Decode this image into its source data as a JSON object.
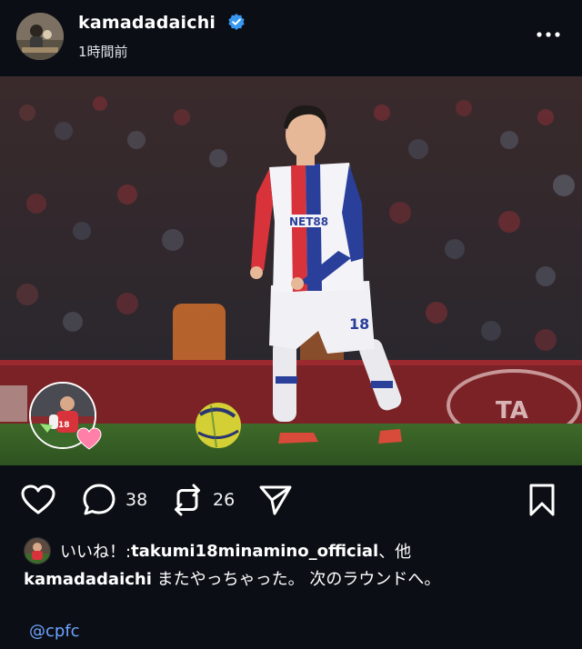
{
  "post": {
    "username": "kamadadaichi",
    "timestamp": "1時間前",
    "verified": true
  },
  "media": {
    "image_description_icon": "photo",
    "jersey_sponsor": "NET88",
    "jersey_number": "18",
    "board_text": "TA"
  },
  "actions": {
    "comments_count": "38",
    "reposts_count": "26"
  },
  "likes": {
    "prefix": "いいね！: ",
    "user": "takumi18minamino_official",
    "suffix": "、他"
  },
  "caption": {
    "user": "kamadadaichi",
    "text": " またやっちゃった。 次のラウンドへ。"
  },
  "mention": "@cpfc",
  "colors": {
    "background": "#0b0f15",
    "verified": "#3897f0",
    "link": "#6ea4ff"
  }
}
